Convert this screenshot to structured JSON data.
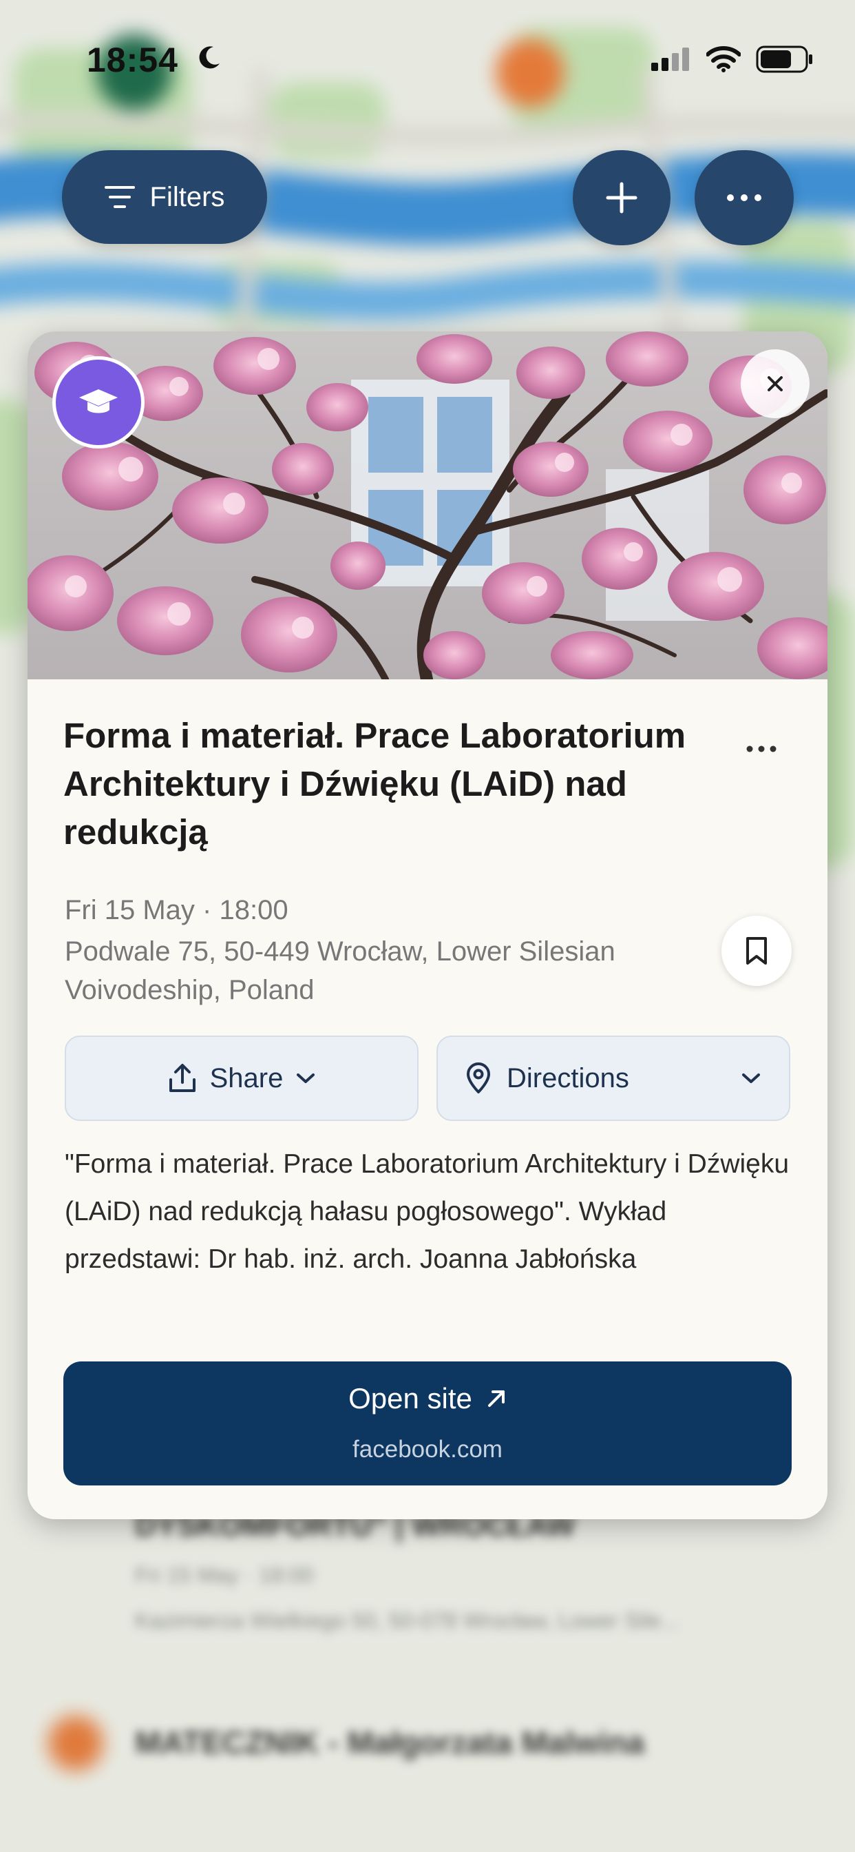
{
  "status_bar": {
    "time": "18:54",
    "icons": [
      "moon-icon",
      "signal-icon",
      "wifi-icon",
      "battery-icon"
    ]
  },
  "toolbar": {
    "filters_label": "Filters",
    "add_icon": "plus-icon",
    "more_icon": "ellipsis-icon"
  },
  "event": {
    "category_icon": "graduation-cap-icon",
    "title": "Forma i materiał. Prace Laboratorium Architektury i Dźwięku (LAiD) nad redukcją",
    "datetime": "Fri 15 May · 18:00",
    "address": "Podwale 75, 50-449 Wrocław, Lower Silesian Voivodeship, Poland",
    "share_label": "Share",
    "directions_label": "Directions",
    "description": "\"Forma i materiał. Prace Laboratorium Architektury i Dźwięku (LAiD) nad redukcją hałasu pogłosowego\". Wykład przedstawi: Dr hab. inż. arch. Joanna Jabłońska",
    "open_site_label": "Open site",
    "open_site_domain": "facebook.com"
  },
  "background_list": [
    {
      "title": "DYSKOMFORTU\" | WROCŁAW",
      "subtitle": "Fri 15 May · 18:00",
      "address": "Kazimierza Wielkiego 50, 50-078 Wrocław, Lower Sile..."
    },
    {
      "title": "MATECZNIK - Małgorzata Malwina"
    }
  ],
  "colors": {
    "toolbar_button": "#27466b",
    "category_badge": "#7a5ae0",
    "open_site_button": "#0d3660",
    "card_background": "#fbf9f4"
  }
}
